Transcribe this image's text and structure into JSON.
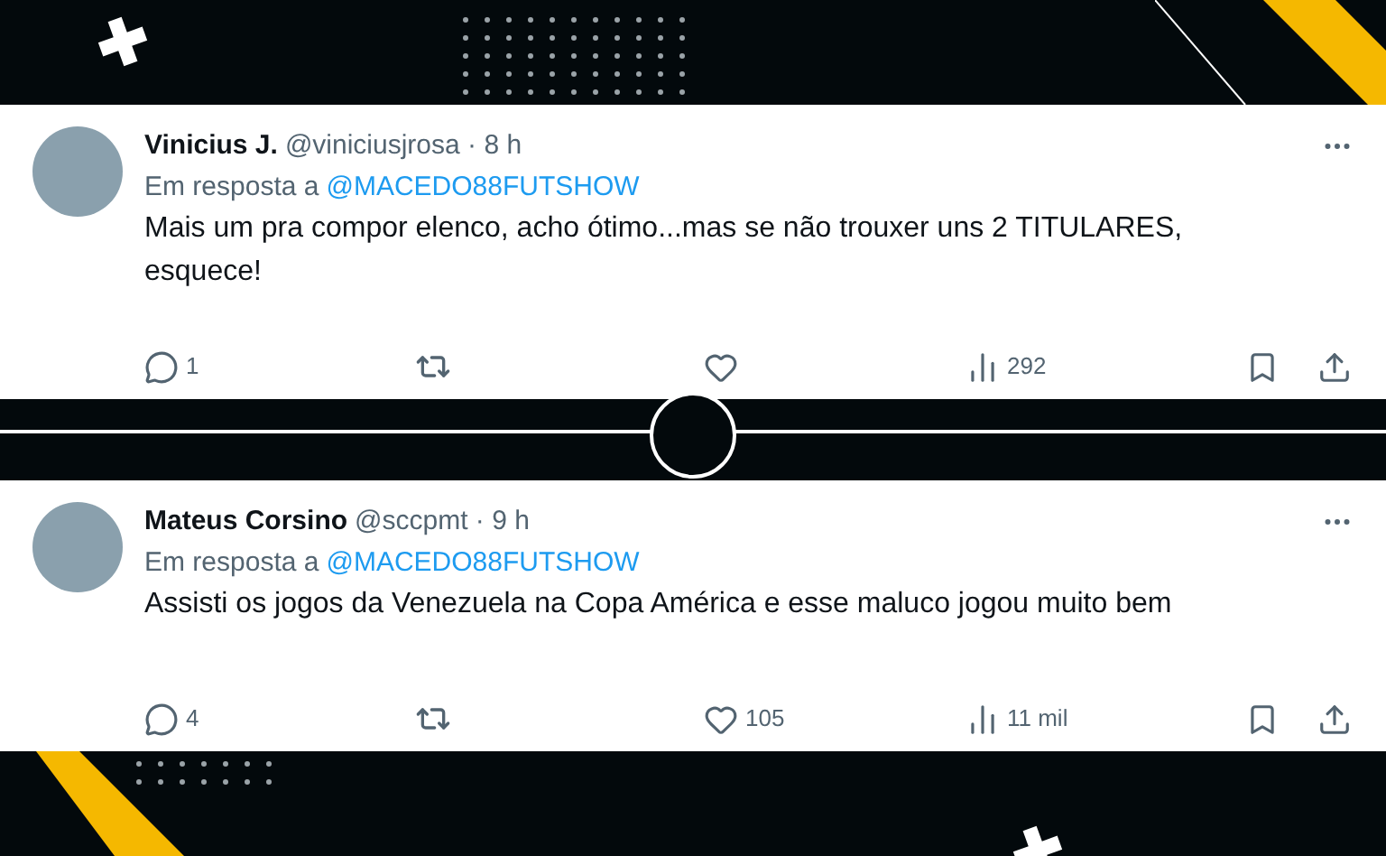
{
  "tweets": [
    {
      "name": "Vinicius J.",
      "handle_time": "@viniciusjrosa · 8 h",
      "reply_prefix": "Em resposta a",
      "reply_to": "@MACEDO88FUTSHOW",
      "text": "Mais um pra compor elenco, acho ótimo...mas se não trouxer uns 2 TITULARES, esquece!",
      "replies": "1",
      "views": "292"
    },
    {
      "name": "Mateus Corsino",
      "handle_time": "@sccpmt · 9 h",
      "reply_prefix": "Em resposta a",
      "reply_to": "@MACEDO88FUTSHOW",
      "text": "Assisti os jogos da Venezuela na Copa América e esse maluco jogou muito bem",
      "replies": "4",
      "likes": "105",
      "views": "11 mil"
    }
  ]
}
